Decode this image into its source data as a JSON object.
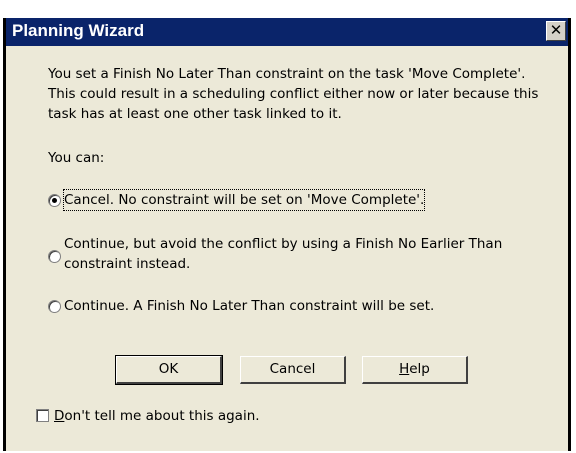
{
  "window": {
    "title": "Planning Wizard",
    "close_glyph": "✕"
  },
  "message": {
    "line1": "You set a Finish No Later Than constraint on the task 'Move Complete'.",
    "line2": "This could result in a scheduling conflict either now or later because this",
    "line3": "task has at least one other task linked to it."
  },
  "prompt": "You can:",
  "options": [
    {
      "label": "Cancel.  No constraint will be set on 'Move Complete'.",
      "selected": true
    },
    {
      "label_line1": "Continue, but avoid the conflict by using a Finish No Earlier Than",
      "label_line2": "constraint instead.",
      "selected": false
    },
    {
      "label": "Continue.  A Finish No Later Than constraint will be set.",
      "selected": false
    }
  ],
  "buttons": {
    "ok": "OK",
    "cancel": "Cancel",
    "help_first": "H",
    "help_rest": "elp"
  },
  "checkbox": {
    "label_first": "D",
    "label_rest": "on't tell me about this again.",
    "checked": false
  }
}
